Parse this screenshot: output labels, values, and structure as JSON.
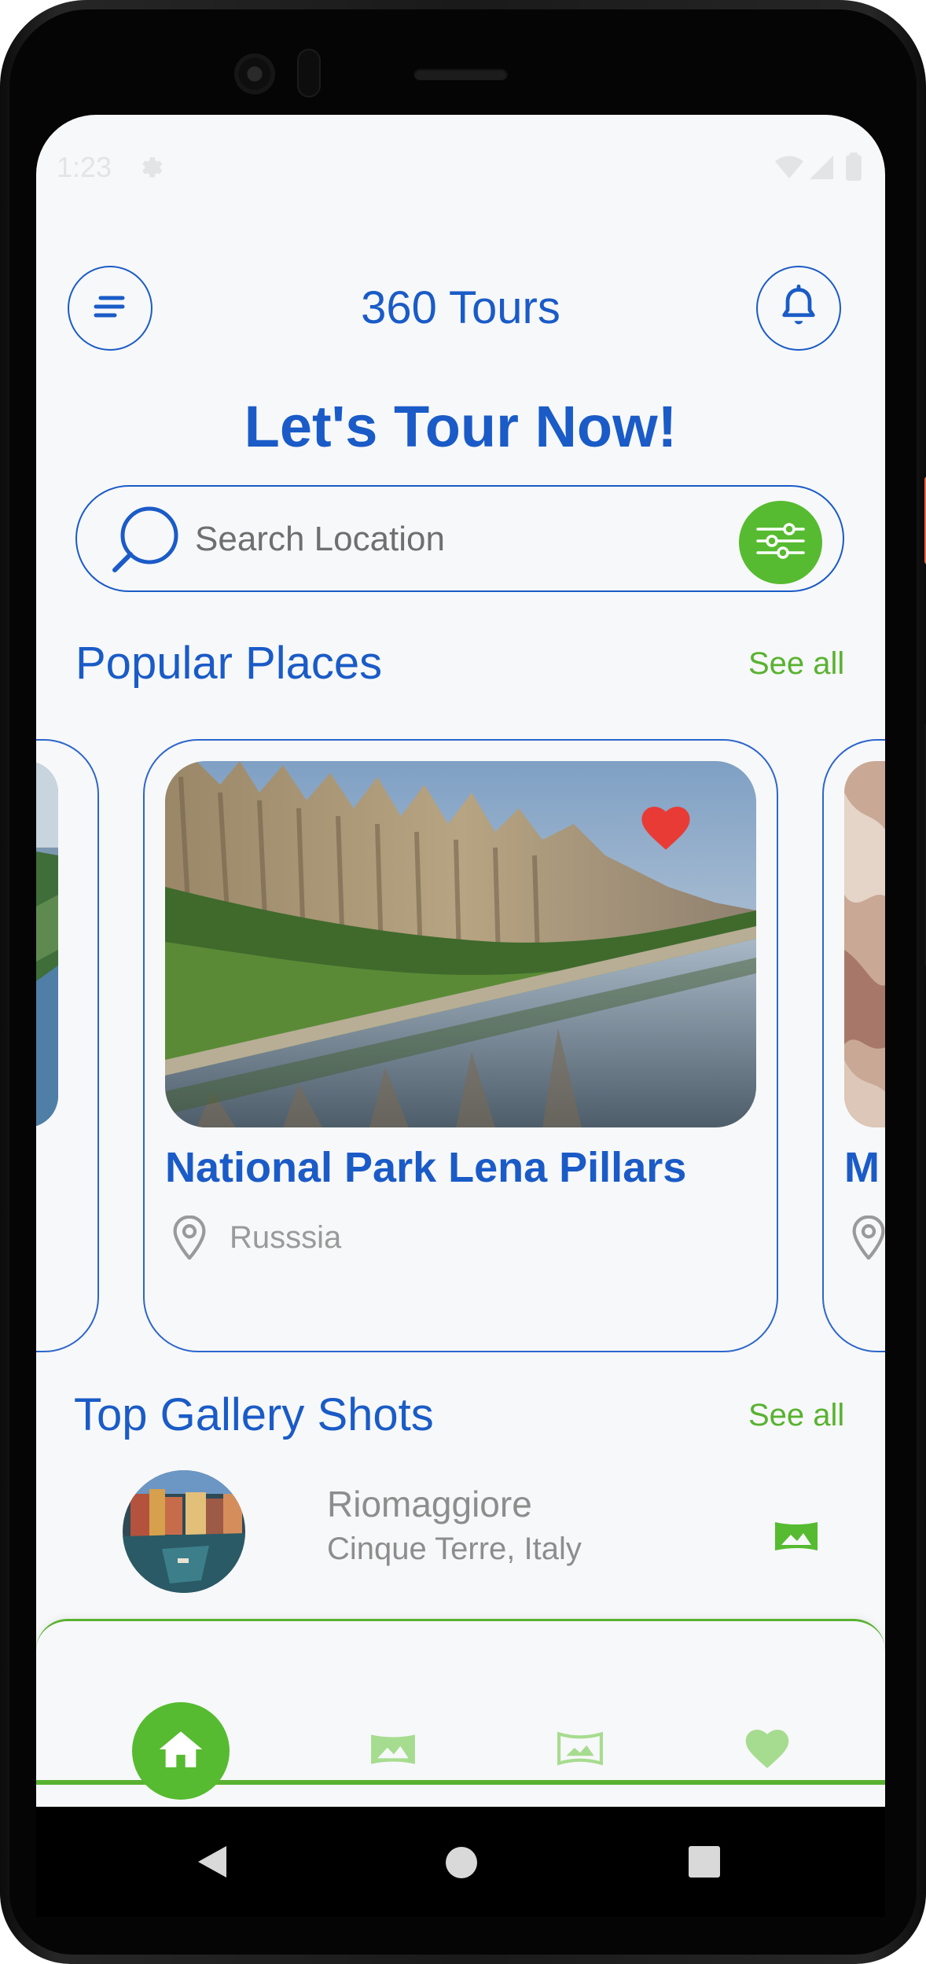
{
  "status_bar": {
    "time": "1:23"
  },
  "header": {
    "title": "360 Tours"
  },
  "headline": "Let's Tour Now!",
  "search": {
    "placeholder": "Search Location",
    "value": ""
  },
  "popular": {
    "title": "Popular Places",
    "see_all": "See all",
    "cards": [
      {
        "name": "National Park Lena Pillars",
        "location": "Russsia",
        "favorite": true
      },
      {
        "name": "M",
        "location": ""
      }
    ]
  },
  "gallery": {
    "title": "Top Gallery Shots",
    "see_all": "See all",
    "items": [
      {
        "name": "Riomaggiore",
        "location": "Cinque Terre, Italy"
      }
    ]
  },
  "bottom_nav": {
    "items": [
      {
        "icon": "home-icon",
        "active": true
      },
      {
        "icon": "image-icon",
        "active": false
      },
      {
        "icon": "panorama-icon",
        "active": false
      },
      {
        "icon": "heart-icon",
        "active": false
      }
    ]
  },
  "colors": {
    "primary": "#1a5bc7",
    "accent": "#56bb30",
    "favorite": "#e83b36",
    "background": "#f7f8f9"
  }
}
